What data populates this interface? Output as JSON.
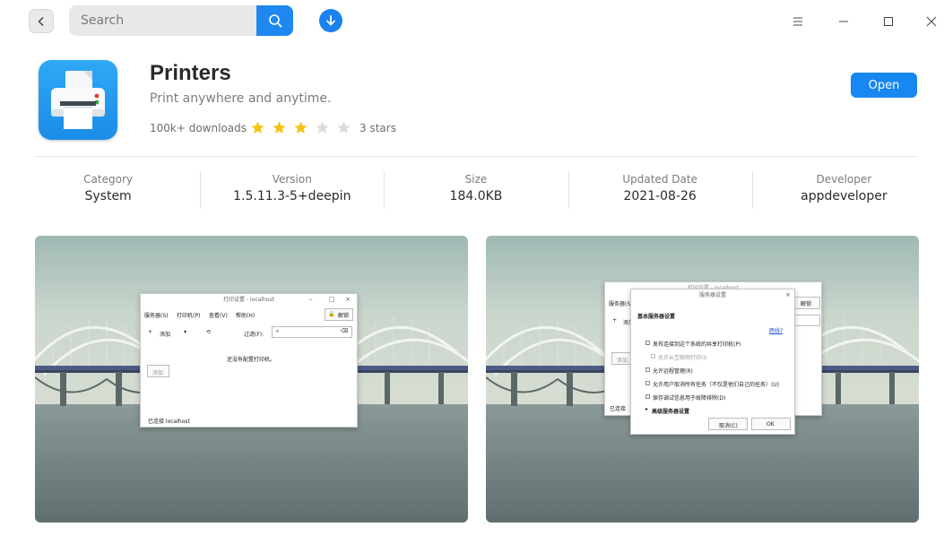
{
  "search": {
    "placeholder": "Search"
  },
  "app": {
    "name": "Printers",
    "tagline": "Print anywhere and anytime.",
    "downloads": "100k+ downloads",
    "rating": 3,
    "rating_max": 5,
    "rating_label": "3 stars",
    "open_label": "Open",
    "accent_color": "#1787f1",
    "star_color": "#f7c315",
    "star_empty_color": "#dcdcdc"
  },
  "info": [
    {
      "label": "Category",
      "value": "System"
    },
    {
      "label": "Version",
      "value": "1.5.11.3-5+deepin"
    },
    {
      "label": "Size",
      "value": "184.0KB"
    },
    {
      "label": "Updated Date",
      "value": "2021-08-26"
    },
    {
      "label": "Developer",
      "value": "appdeveloper"
    }
  ],
  "screenshots": {
    "shot1": {
      "title": "打印设置 - localhost",
      "menu": [
        "服务器(S)",
        "打印机(P)",
        "查看(V)",
        "帮助(H)"
      ],
      "unlock": "解锁",
      "add": "添加",
      "filter": "过滤(F):",
      "message": "还没有配置打印机。",
      "add_btn": "添加",
      "status": "已连接 localhost"
    },
    "shot2": {
      "bg_title": "打印设置 - localhost",
      "bg_menu": "服务器(S)",
      "bg_unlock": "解锁",
      "bg_add": "添加",
      "bg_add_btn": "添加",
      "bg_status": "已连接",
      "title": "服务器设置",
      "heading": "基本服务器设置",
      "link": "跨线?",
      "options": [
        "发布连接到这个系统的共享打印机(P)",
        "允许从互联网打印(I)",
        "允许远程管理(R)",
        "允许用户取消所有任务（不仅是他们自己的任务）(U)",
        "保存调试信息用于故障排除(D)"
      ],
      "advanced": "高级服务器设置",
      "cancel": "取消(C)",
      "ok": "OK"
    }
  }
}
